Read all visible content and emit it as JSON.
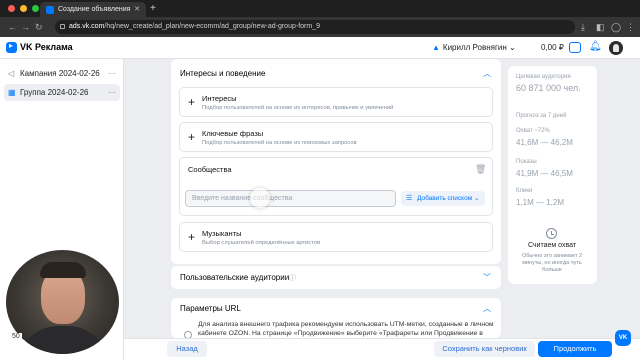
{
  "browser": {
    "tab_title": "Создание объявления",
    "url_host": "ads.vk.com",
    "url_path": "/hq/new_create/ad_plan/new-ecomm/ad_group/new-ad-group-form_9"
  },
  "header": {
    "brand": "VK Реклама",
    "user_name": "Кирилл Ровнягин",
    "balance": "0,00 ₽"
  },
  "sidebar": {
    "items": [
      {
        "label": "Кампания 2024-02-26"
      },
      {
        "label": "Группа 2024-02-26"
      }
    ]
  },
  "interests": {
    "title": "Интересы и поведение",
    "options": [
      {
        "title": "Интересы",
        "sub": "Подбор пользователей на основе их интересов, привычек и увлечений"
      },
      {
        "title": "Ключевые фразы",
        "sub": "Подбор пользователей на основе их поисковых запросов"
      },
      {
        "title": "Музыканты",
        "sub": "Выбор слушателей определённых артистов"
      }
    ],
    "communities_title": "Сообщества",
    "communities_placeholder": "Введите название сообщества",
    "add_list": "Добавить списком"
  },
  "custom_audiences": {
    "title": "Пользовательские аудитории"
  },
  "url_params": {
    "title": "Параметры URL",
    "text": "Для анализа внешнего трафика рекомендуем использовать UTM-метки, созданные в личном кабинете OZON. На странице «Продвижение» выберите «Трафареты или Продвижение в"
  },
  "forecast": {
    "audience_label": "Целевая аудитория",
    "audience_value": "60 871 000 чел.",
    "period_label": "Прогноз за 7 дней",
    "reach_label": "Охват ~72%",
    "reach_value": "41,6M — 46,2M",
    "impressions_label": "Показы",
    "impressions_value": "41,9M — 46,5M",
    "clicks_label": "Клики",
    "clicks_value": "1,1M — 1,2M",
    "calc_title": "Считаем охват",
    "calc_desc": "Обычно это занимает 2 минуты, но иногда чуть больше"
  },
  "footer": {
    "back": "Назад",
    "save_draft": "Сохранить как черновик",
    "continue": "Продолжить"
  },
  "webcam": {
    "badge": "50"
  },
  "colors": {
    "accent": "#0077ff",
    "page_bg": "#ebedf0",
    "muted": "#99a2ad"
  }
}
